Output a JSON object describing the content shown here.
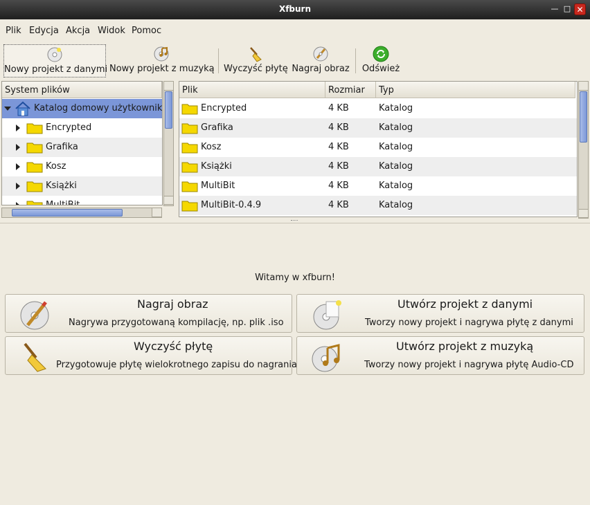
{
  "window": {
    "title": "Xfburn"
  },
  "menu": [
    "Plik",
    "Edycja",
    "Akcja",
    "Widok",
    "Pomoc"
  ],
  "toolbar": [
    {
      "label": "Nowy projekt z danymi",
      "icon": "cd-data-icon"
    },
    {
      "label": "Nowy projekt z muzyką",
      "icon": "cd-audio-icon"
    },
    {
      "label": "Wyczyść płytę",
      "icon": "broom-icon"
    },
    {
      "label": "Nagraj obraz",
      "icon": "burn-image-icon"
    },
    {
      "label": "Odśwież",
      "icon": "refresh-icon"
    }
  ],
  "filesystem": {
    "header": "System plików",
    "root": "Katalog domowy użytkownika",
    "items": [
      "Encrypted",
      "Grafika",
      "Kosz",
      "Książki",
      "MultiBit"
    ]
  },
  "files": {
    "headers": [
      "Plik",
      "Rozmiar",
      "Typ"
    ],
    "rows": [
      {
        "name": "Encrypted",
        "size": "4 KB",
        "type": "Katalog"
      },
      {
        "name": "Grafika",
        "size": "4 KB",
        "type": "Katalog"
      },
      {
        "name": "Kosz",
        "size": "4 KB",
        "type": "Katalog"
      },
      {
        "name": "Książki",
        "size": "4 KB",
        "type": "Katalog"
      },
      {
        "name": "MultiBit",
        "size": "4 KB",
        "type": "Katalog"
      },
      {
        "name": "MultiBit-0.4.9",
        "size": "4 KB",
        "type": "Katalog"
      }
    ]
  },
  "welcome": {
    "text": "Witamy w xfburn!",
    "actions": [
      {
        "title": "Nagraj obraz",
        "desc": "Nagrywa przygotowaną kompilację, np. plik .iso"
      },
      {
        "title": "Utwórz projekt z danymi",
        "desc": "Tworzy nowy projekt i nagrywa płytę z danymi"
      },
      {
        "title": "Wyczyść płytę",
        "desc": "Przygotowuje płytę wielokrotnego zapisu do nagrania"
      },
      {
        "title": "Utwórz projekt z muzyką",
        "desc": "Tworzy nowy projekt i nagrywa płytę Audio-CD"
      }
    ]
  }
}
